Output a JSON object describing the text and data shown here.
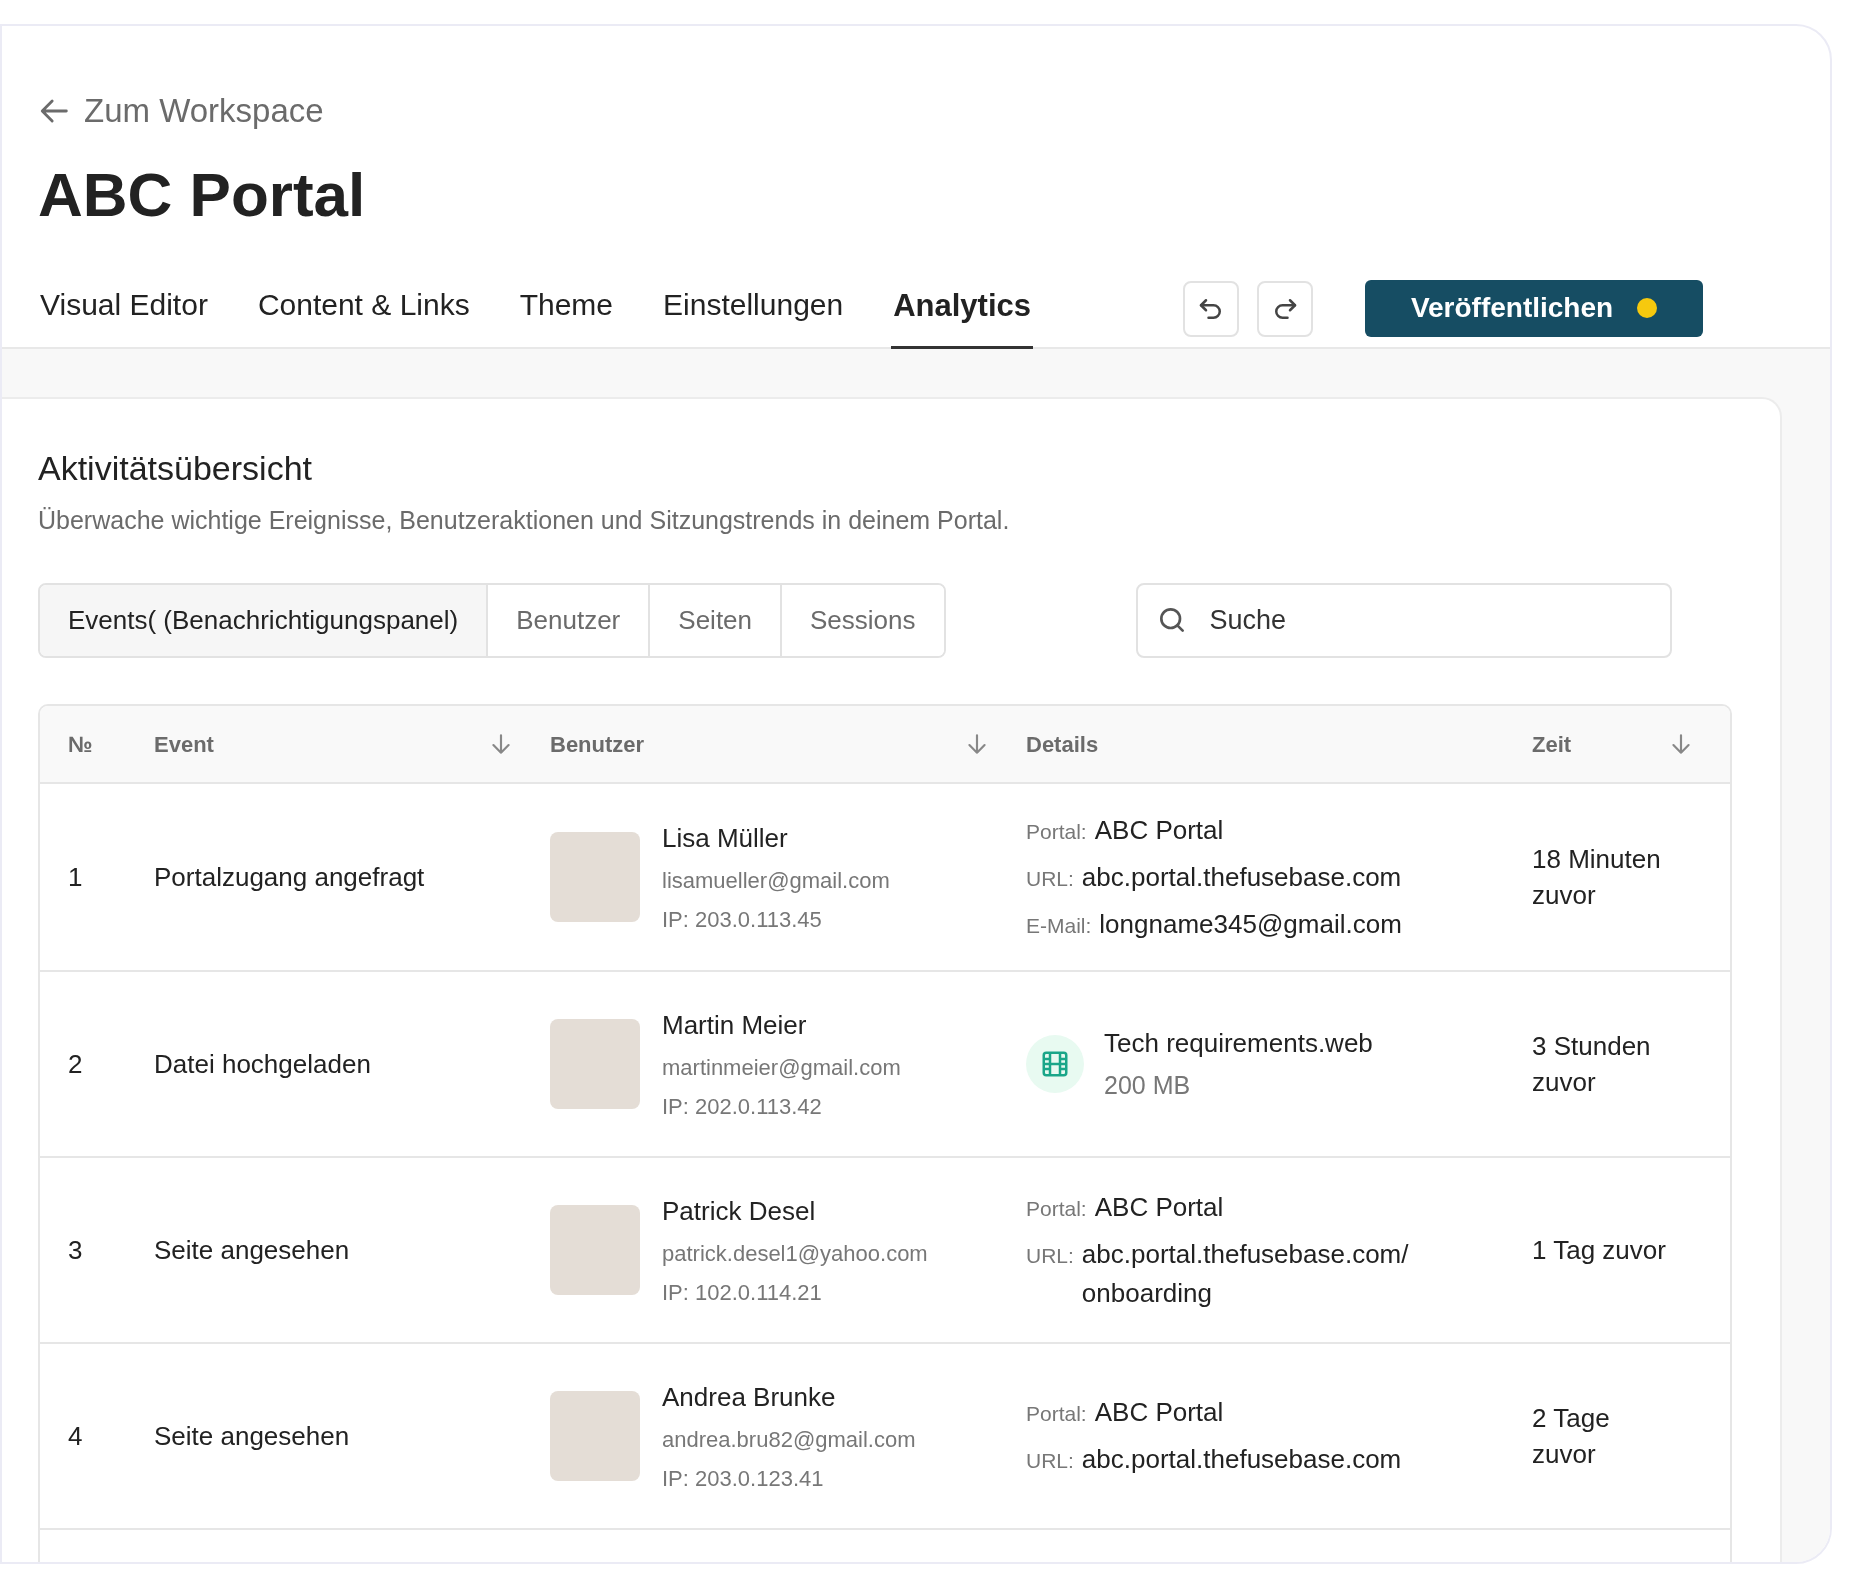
{
  "back_link": {
    "label": "Zum Workspace"
  },
  "title": "ABC Portal",
  "tabs": [
    {
      "label": "Visual Editor",
      "selected": false
    },
    {
      "label": "Content & Links",
      "selected": false
    },
    {
      "label": "Theme",
      "selected": false
    },
    {
      "label": "Einstellungen",
      "selected": false
    },
    {
      "label": "Analytics",
      "selected": true
    }
  ],
  "publish_button": {
    "label": "Veröffentlichen",
    "unsaved_changes": true
  },
  "section": {
    "title": "Aktivitätsübersicht",
    "subtitle": "Überwache wichtige Ereignisse, Benutzeraktionen und Sitzungstrends in deinem Portal."
  },
  "filters": [
    {
      "label": "Events( (Benachrichtigungspanel)",
      "selected": true
    },
    {
      "label": "Benutzer",
      "selected": false
    },
    {
      "label": "Seiten",
      "selected": false
    },
    {
      "label": "Sessions",
      "selected": false
    }
  ],
  "search": {
    "placeholder": "Suche"
  },
  "table": {
    "columns": [
      {
        "label": "№",
        "sortable": false
      },
      {
        "label": "Event",
        "sortable": true
      },
      {
        "label": "Benutzer",
        "sortable": true
      },
      {
        "label": "Details",
        "sortable": false
      },
      {
        "label": "Zeit",
        "sortable": true
      }
    ],
    "rows": [
      {
        "number": "1",
        "event": "Portalzugang angefragt",
        "user": {
          "name": "Lisa Müller",
          "email": "lisamueller@gmail.com",
          "ip": "IP: 203.0.113.45"
        },
        "details": {
          "kind": "fields",
          "fields": [
            {
              "label": "Portal:",
              "value": "ABC Portal"
            },
            {
              "label": "URL:",
              "value": "abc.portal.thefusebase.com"
            },
            {
              "label": "E-Mail:",
              "value": "longname345@gmail.com"
            }
          ]
        },
        "time": "18 Minuten zuvor"
      },
      {
        "number": "2",
        "event": "Datei hochgeladen",
        "user": {
          "name": "Martin Meier",
          "email": "martinmeier@gmail.com",
          "ip": "IP: 202.0.113.42"
        },
        "details": {
          "kind": "file",
          "name": "Tech requirements.web",
          "size": "200 MB"
        },
        "time": "3 Stunden zuvor"
      },
      {
        "number": "3",
        "event": "Seite angesehen",
        "user": {
          "name": "Patrick Desel",
          "email": "patrick.desel1@yahoo.com",
          "ip": "IP: 102.0.114.21"
        },
        "details": {
          "kind": "fields",
          "fields": [
            {
              "label": "Portal:",
              "value": "ABC Portal"
            },
            {
              "label": "URL:",
              "value": "abc.portal.thefusebase.com/ onboarding"
            }
          ]
        },
        "time": "1 Tag zuvor"
      },
      {
        "number": "4",
        "event": "Seite angesehen",
        "user": {
          "name": "Andrea Brunke",
          "email": "andrea.bru82@gmail.com",
          "ip": "IP: 203.0.123.41"
        },
        "details": {
          "kind": "fields",
          "fields": [
            {
              "label": "Portal:",
              "value": "ABC Portal"
            },
            {
              "label": "URL:",
              "value": "abc.portal.thefusebase.com"
            }
          ]
        },
        "time": "2 Tage zuvor"
      }
    ]
  }
}
